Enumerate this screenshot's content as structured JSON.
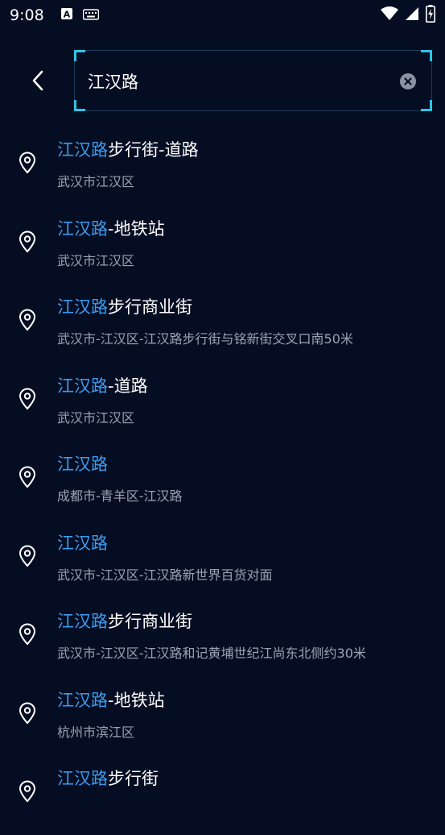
{
  "status": {
    "time": "9:08",
    "left_icons": [
      "a-notification-icon",
      "keyboard-icon"
    ],
    "right_icons": [
      "wifi-icon",
      "signal-icon",
      "battery-charging-icon"
    ]
  },
  "search": {
    "value": "江汉路",
    "back_icon": "chevron-left-icon",
    "clear_icon": "clear-circle-icon"
  },
  "colors": {
    "background": "#050d22",
    "highlight": "#3a9cf0",
    "accent_corner": "#2ec4e6",
    "subtitle": "#9aa3b2"
  },
  "results": [
    {
      "highlight": "江汉路",
      "rest": "步行街-道路",
      "subtitle": "武汉市江汉区"
    },
    {
      "highlight": "江汉路",
      "rest": "-地铁站",
      "subtitle": "武汉市江汉区"
    },
    {
      "highlight": "江汉路",
      "rest": "步行商业街",
      "subtitle": "武汉市-江汉区-江汉路步行街与铭新街交叉口南50米"
    },
    {
      "highlight": "江汉路",
      "rest": "-道路",
      "subtitle": "武汉市江汉区"
    },
    {
      "highlight": "江汉路",
      "rest": "",
      "subtitle": "成都市-青羊区-江汉路"
    },
    {
      "highlight": "江汉路",
      "rest": "",
      "subtitle": "武汉市-江汉区-江汉路新世界百货对面"
    },
    {
      "highlight": "江汉路",
      "rest": "步行商业街",
      "subtitle": "武汉市-江汉区-江汉路和记黄埔世纪江尚东北侧约30米"
    },
    {
      "highlight": "江汉路",
      "rest": "-地铁站",
      "subtitle": "杭州市滨江区"
    },
    {
      "highlight": "江汉路",
      "rest": "步行街",
      "subtitle": ""
    }
  ]
}
